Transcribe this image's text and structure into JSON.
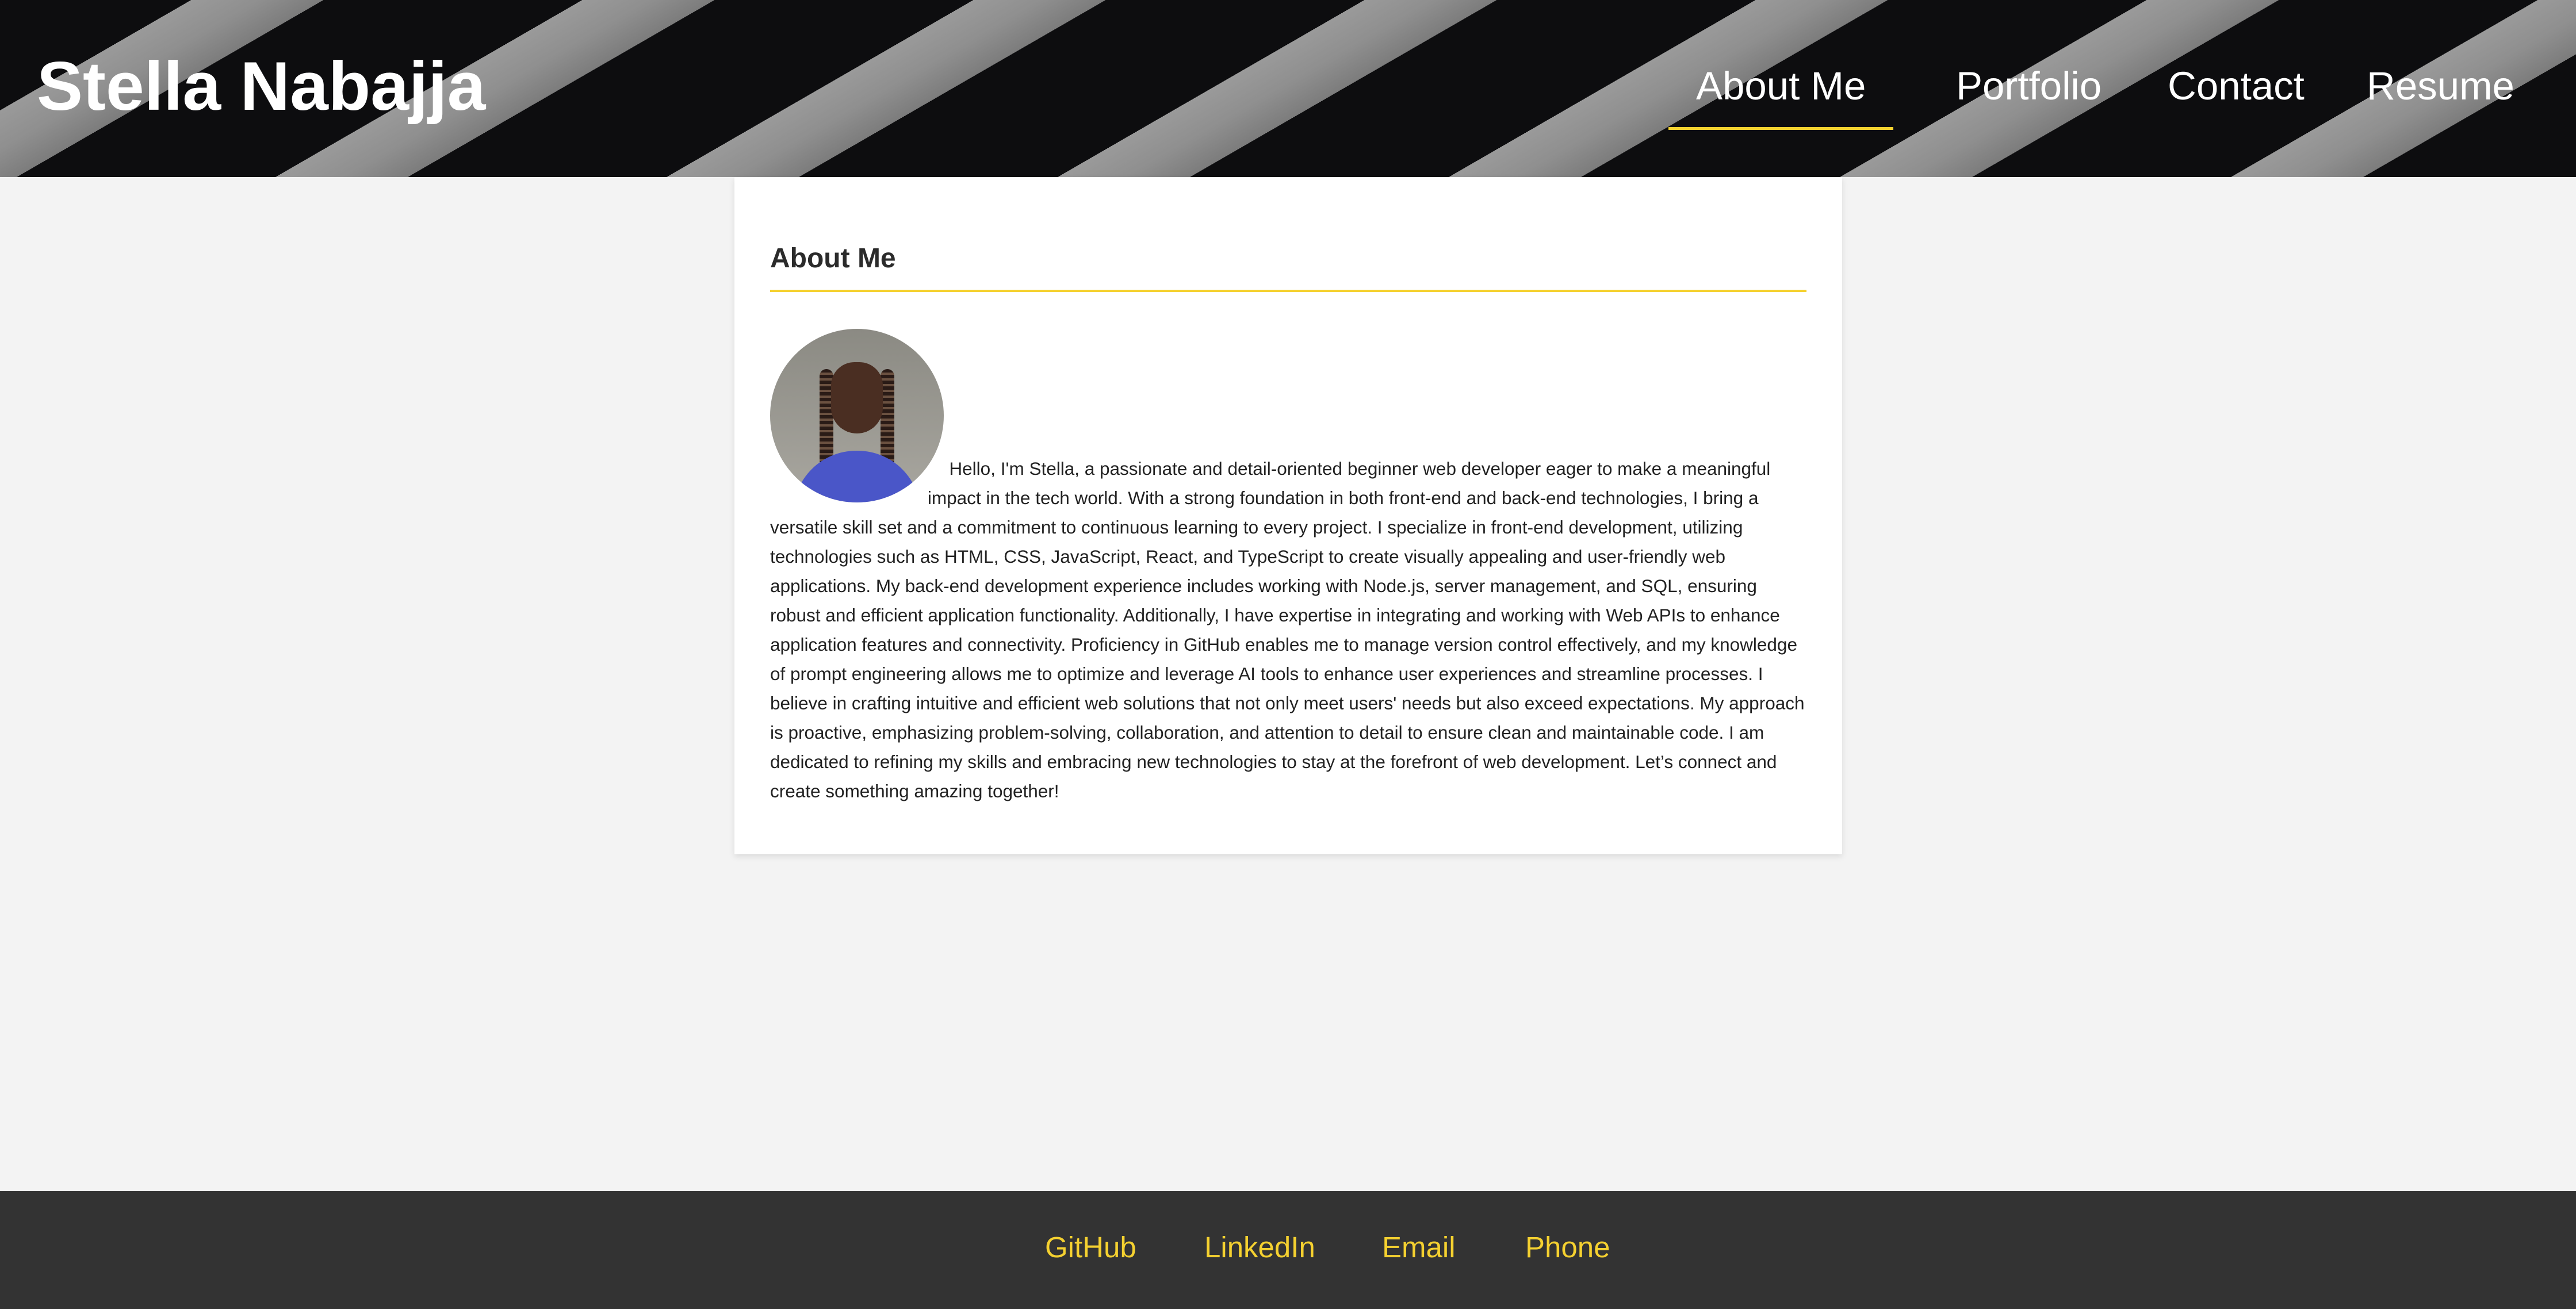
{
  "header": {
    "title": "Stella Nabajja",
    "nav": [
      {
        "label": "About Me",
        "active": true
      },
      {
        "label": "Portfolio",
        "active": false
      },
      {
        "label": "Contact",
        "active": false
      },
      {
        "label": "Resume",
        "active": false
      }
    ]
  },
  "about": {
    "heading": "About Me",
    "bio": "Hello, I'm Stella, a passionate and detail-oriented beginner web developer eager to make a meaningful impact in the tech world. With a strong foundation in both front-end and back-end technologies, I bring a versatile skill set and a commitment to continuous learning to every project. I specialize in front-end development, utilizing technologies such as HTML, CSS, JavaScript, React, and TypeScript to create visually appealing and user-friendly web applications. My back-end development experience includes working with Node.js, server management, and SQL, ensuring robust and efficient application functionality. Additionally, I have expertise in integrating and working with Web APIs to enhance application features and connectivity. Proficiency in GitHub enables me to manage version control effectively, and my knowledge of prompt engineering allows me to optimize and leverage AI tools to enhance user experiences and streamline processes. I believe in crafting intuitive and efficient web solutions that not only meet users' needs but also exceed expectations. My approach is proactive, emphasizing problem-solving, collaboration, and attention to detail to ensure clean and maintainable code. I am dedicated to refining my skills and embracing new technologies to stay at the forefront of web development. Let’s connect and create something amazing together!"
  },
  "footer": {
    "links": [
      "GitHub",
      "LinkedIn",
      "Email",
      "Phone"
    ]
  },
  "colors": {
    "accent": "#f5d130",
    "footer_bg": "#333333",
    "page_bg": "#f3f3f3"
  }
}
